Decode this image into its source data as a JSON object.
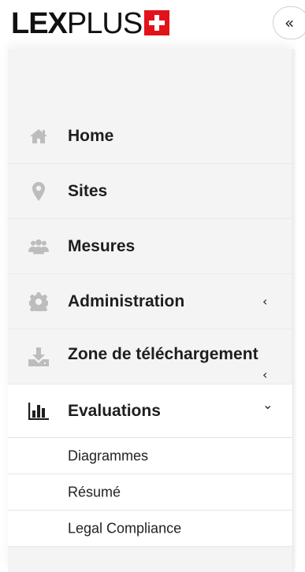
{
  "brand": {
    "bold": "LEX",
    "regular": "PLUS"
  },
  "collapse_button": {
    "label": "«",
    "icon": "double-chevron-left-icon"
  },
  "menu": [
    {
      "key": "home",
      "label": "Home",
      "icon": "home-icon",
      "arrow": ""
    },
    {
      "key": "sites",
      "label": "Sites",
      "icon": "map-marker-icon",
      "arrow": ""
    },
    {
      "key": "mesures",
      "label": "Mesures",
      "icon": "users-icon",
      "arrow": ""
    },
    {
      "key": "administration",
      "label": "Administration",
      "icon": "gear-icon",
      "arrow": "‹"
    },
    {
      "key": "zone",
      "label": "Zone de téléchargement",
      "icon": "download-icon",
      "arrow": "‹"
    },
    {
      "key": "evaluations",
      "label": "Evaluations",
      "icon": "bar-chart-icon",
      "arrow": "⌄"
    }
  ],
  "submenu": [
    {
      "label": "Diagrammes"
    },
    {
      "label": "Résumé"
    },
    {
      "label": "Legal Compliance"
    }
  ],
  "colors": {
    "accent": "#e2121b",
    "icon_gray": "#bdbdbd",
    "sidebar_bg": "#f4f4f4"
  }
}
